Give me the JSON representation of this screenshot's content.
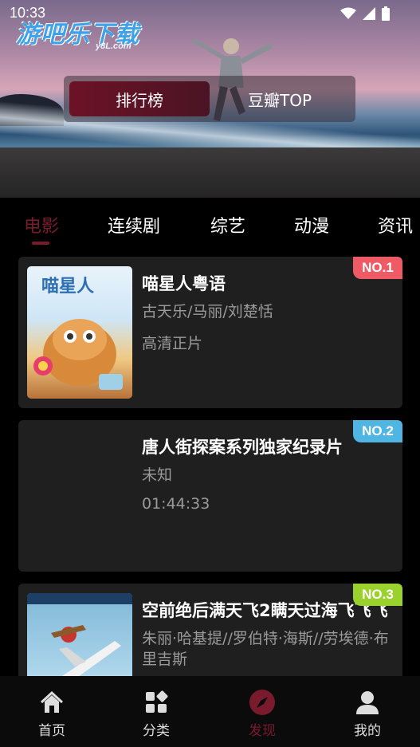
{
  "status_bar": {
    "time": "10:33"
  },
  "logo": {
    "main": "游吧乐下载",
    "sub": "y8L.com"
  },
  "segments": [
    {
      "label": "排行榜",
      "active": true
    },
    {
      "label": "豆瓣TOP",
      "active": false
    }
  ],
  "tabs": [
    {
      "label": "电影",
      "active": true
    },
    {
      "label": "连续剧",
      "active": false
    },
    {
      "label": "综艺",
      "active": false
    },
    {
      "label": "动漫",
      "active": false
    },
    {
      "label": "资讯",
      "active": false
    }
  ],
  "cards": [
    {
      "rank": "NO.1",
      "rank_color": "#ef5b64",
      "title": "喵星人粤语",
      "actors": "古天乐/马丽/刘楚恬",
      "meta": "高清正片",
      "poster": "cat-movie-poster"
    },
    {
      "rank": "NO.2",
      "rank_color": "#4fb6e4",
      "title": "唐人街探案系列独家纪录片",
      "actors": "未知",
      "meta": "01:44:33",
      "poster": "blank-poster"
    },
    {
      "rank": "NO.3",
      "rank_color": "#9bd12d",
      "title": "空前绝后满天飞2瞒天过海飞飞飞",
      "actors": "朱丽·哈基提//罗伯特·海斯//劳埃德·布里吉斯",
      "meta": "",
      "poster": "airplane-movie-poster"
    }
  ],
  "poster_text": {
    "cat_movie": "喵星人"
  },
  "bottom_nav": [
    {
      "label": "首页",
      "icon": "home-icon",
      "active": false
    },
    {
      "label": "分类",
      "icon": "category-icon",
      "active": false
    },
    {
      "label": "发现",
      "icon": "compass-icon",
      "active": true
    },
    {
      "label": "我的",
      "icon": "user-icon",
      "active": false
    }
  ],
  "colors": {
    "accent": "#7a1a2d",
    "card_bg": "#1f1f1f",
    "background": "#000000"
  }
}
